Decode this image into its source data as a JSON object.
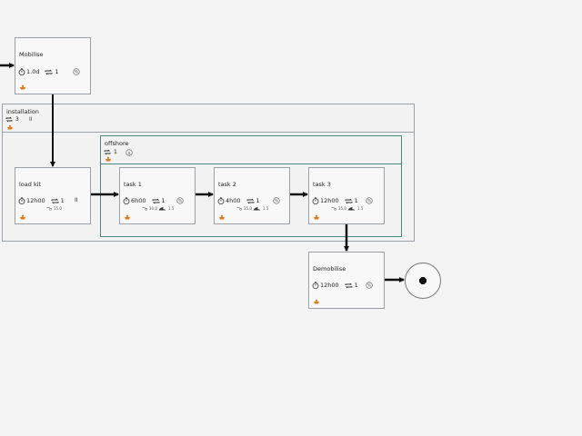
{
  "containers": {
    "installation": {
      "title": "installation",
      "repeat": "3",
      "flag": "II"
    },
    "offshore": {
      "title": "offshore",
      "repeat": "1",
      "flag": "$"
    }
  },
  "nodes": {
    "mobilise": {
      "title": "Mobilise",
      "duration": "1.0d",
      "count": "1",
      "flag": "%"
    },
    "load_kit": {
      "title": "load kit",
      "duration": "12h00",
      "count": "1",
      "flag": "II",
      "sub1": "15.0"
    },
    "task1": {
      "title": "task 1",
      "duration": "6h00",
      "count": "1",
      "flag": "%",
      "sub1": "10.0",
      "sub2": "1.5"
    },
    "task2": {
      "title": "task 2",
      "duration": "4h00",
      "count": "1",
      "flag": "%",
      "sub1": "15.0",
      "sub2": "1.5"
    },
    "task3": {
      "title": "task 3",
      "duration": "12h00",
      "count": "1",
      "flag": "%",
      "sub1": "15.0",
      "sub2": "1.5"
    },
    "demobilise": {
      "title": "Demobilise",
      "duration": "12h00",
      "count": "1",
      "flag": "%"
    }
  },
  "icons": {
    "duration": "stopwatch-icon",
    "repeat": "repeat-icon",
    "resource": "vessel-icon",
    "weather": "wave-icon",
    "limit": "wind-limit-icon",
    "end": "stop-icon"
  },
  "colors": {
    "installation_border": "#9aa3ab",
    "offshore_border": "#4b8b80",
    "resource_icon": "#e07a1e",
    "arrow": "#111111"
  }
}
